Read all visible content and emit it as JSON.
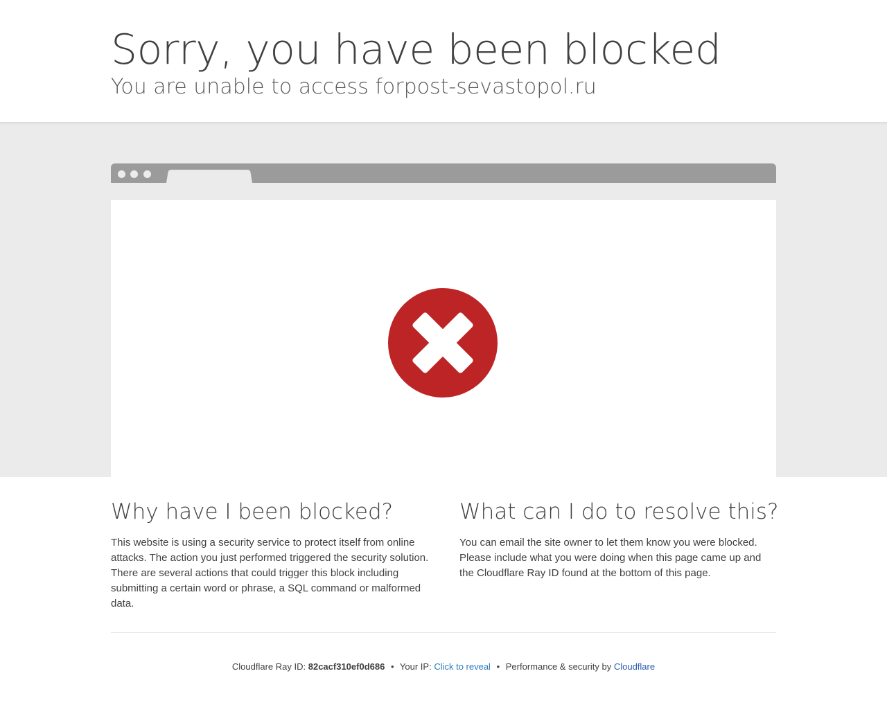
{
  "header": {
    "title": "Sorry, you have been blocked",
    "subtitle": "You are unable to access forpost-sevastopol.ru"
  },
  "illustration": {
    "icon": "blocked-x-icon",
    "icon_color": "#bd2426"
  },
  "why": {
    "heading": "Why have I been blocked?",
    "body": "This website is using a security service to protect itself from online attacks. The action you just performed triggered the security solution. There are several actions that could trigger this block including submitting a certain word or phrase, a SQL command or malformed data."
  },
  "resolve": {
    "heading": "What can I do to resolve this?",
    "body": "You can email the site owner to let them know you were blocked. Please include what you were doing when this page came up and the Cloudflare Ray ID found at the bottom of this page."
  },
  "footer": {
    "ray_label": "Cloudflare Ray ID:",
    "ray_id": "82cacf310ef0d686",
    "separator": "•",
    "ip_label": "Your IP:",
    "ip_link": "Click to reveal",
    "perf_label": "Performance & security by",
    "cf_link": "Cloudflare",
    "link_color": "#2f7bbf"
  }
}
